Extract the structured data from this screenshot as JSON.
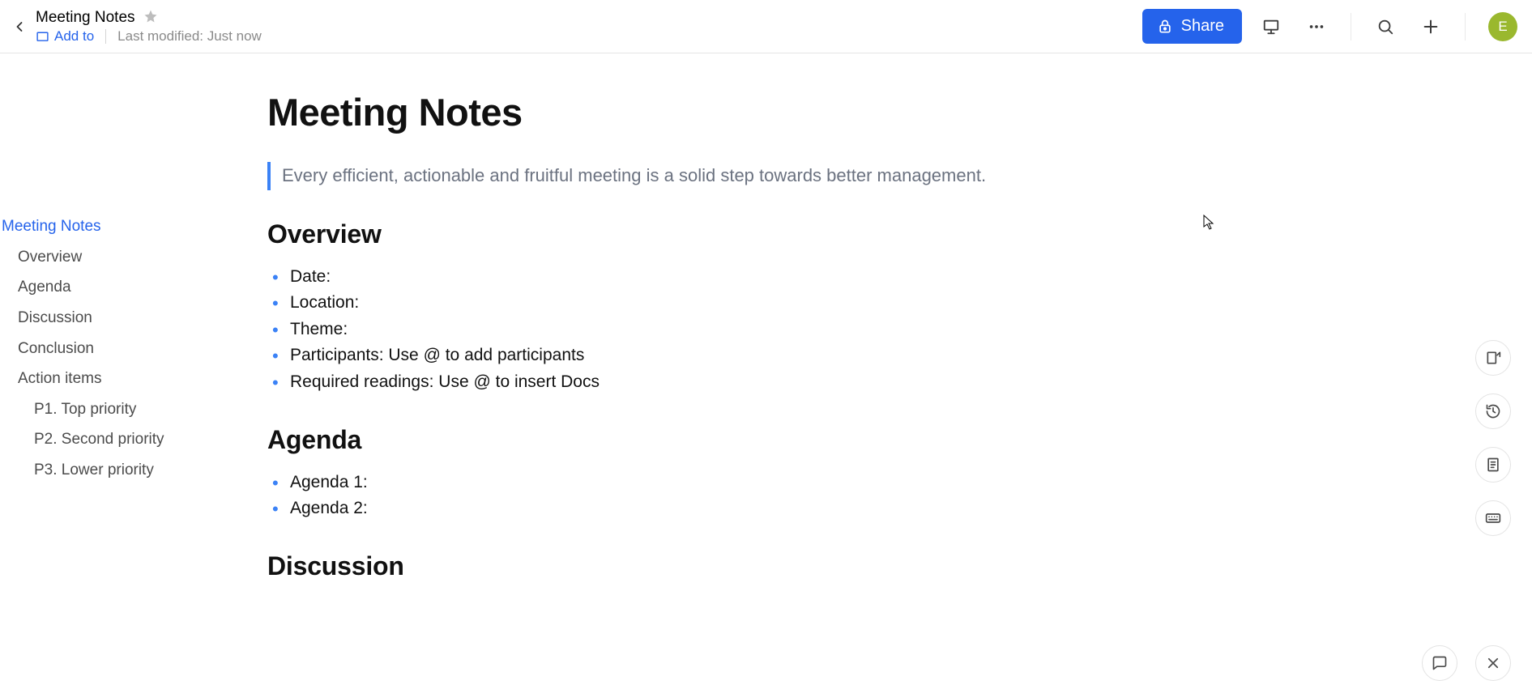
{
  "header": {
    "doc_title": "Meeting Notes",
    "add_to_label": "Add to",
    "last_modified": "Last modified: Just now",
    "share_label": "Share",
    "avatar_initial": "E"
  },
  "outline": {
    "items": [
      {
        "label": "Meeting Notes",
        "level": 0,
        "active": true
      },
      {
        "label": "Overview",
        "level": 1,
        "active": false
      },
      {
        "label": "Agenda",
        "level": 1,
        "active": false
      },
      {
        "label": "Discussion",
        "level": 1,
        "active": false
      },
      {
        "label": "Conclusion",
        "level": 1,
        "active": false
      },
      {
        "label": "Action items",
        "level": 1,
        "active": false
      },
      {
        "label": "P1. Top priority",
        "level": 2,
        "active": false
      },
      {
        "label": "P2. Second priority",
        "level": 2,
        "active": false
      },
      {
        "label": "P3. Lower priority",
        "level": 2,
        "active": false
      }
    ]
  },
  "document": {
    "title": "Meeting Notes",
    "quote": "Every efficient, actionable and fruitful meeting is a solid step towards better management.",
    "sections": {
      "overview": {
        "heading": "Overview",
        "bullets": [
          "Date:",
          "Location:",
          "Theme:",
          "Participants:  Use @ to add participants",
          "Required readings:  Use @ to insert Docs"
        ]
      },
      "agenda": {
        "heading": "Agenda",
        "bullets": [
          "Agenda 1:",
          "Agenda 2:"
        ]
      },
      "discussion": {
        "heading": "Discussion"
      }
    }
  }
}
